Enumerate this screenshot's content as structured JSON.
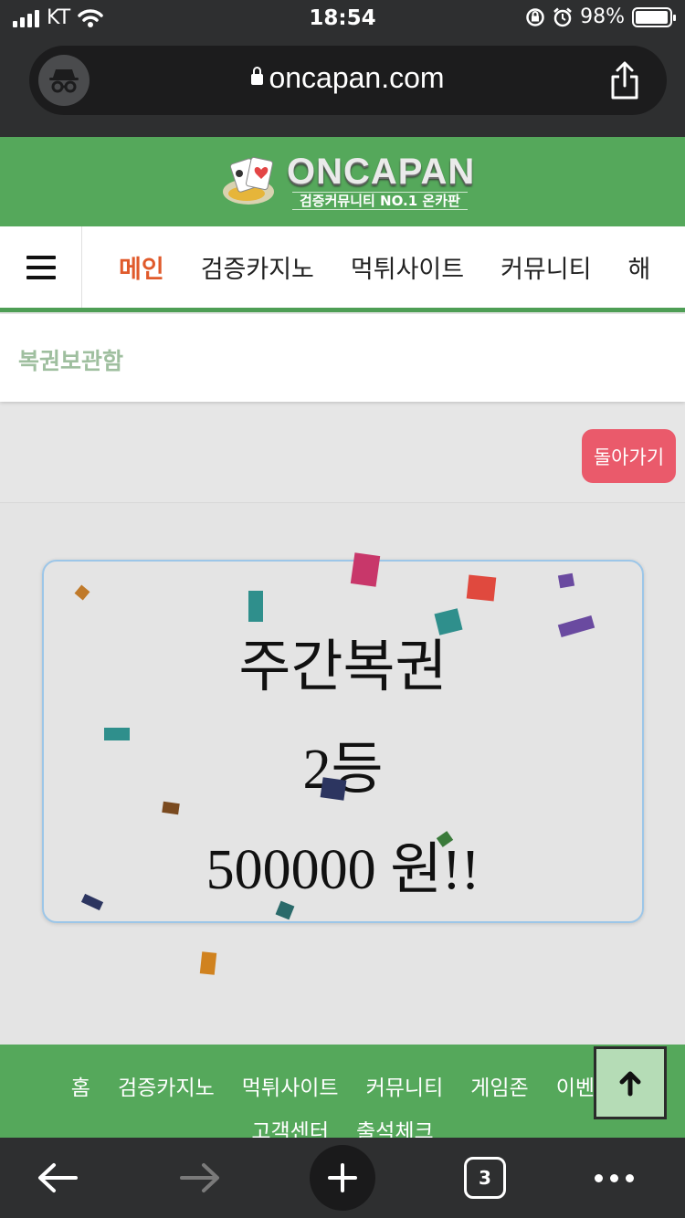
{
  "status_bar": {
    "carrier": "KT",
    "time": "18:54",
    "battery": "98%",
    "battery_level": 0.98
  },
  "browser": {
    "url": "oncapan.com",
    "tab_count": "3"
  },
  "site": {
    "logo_name": "ONCAPAN",
    "logo_tagline": "검증커뮤니티 NO.1 온카판",
    "nav_items": [
      "메인",
      "검증카지노",
      "먹튀사이트",
      "커뮤니티",
      "해"
    ],
    "breadcrumb": "복권보관함",
    "back_button": "돌아가기"
  },
  "lottery_card": {
    "title": "주간복권",
    "rank": "2등",
    "prize": "500000 원!!"
  },
  "footer": {
    "row1": [
      "홈",
      "검증카지노",
      "먹튀사이트",
      "커뮤니티",
      "게임존",
      "이벤트"
    ],
    "row2": [
      "고객센터",
      "출석체크"
    ]
  },
  "colors": {
    "brand_green": "#55a85b",
    "nav_active": "#e05a2b",
    "back_button": "#ea5a6b",
    "card_border": "#9cc6e8",
    "top_button_bg": "#b5dcb6"
  },
  "icons": {
    "incognito": "incognito-icon",
    "share": "share-icon",
    "menu": "hamburger-menu-icon",
    "scroll_top": "arrow-up-icon",
    "back": "arrow-left-icon",
    "forward": "arrow-right-icon",
    "new_tab": "plus-icon",
    "more": "more-dots-icon"
  }
}
